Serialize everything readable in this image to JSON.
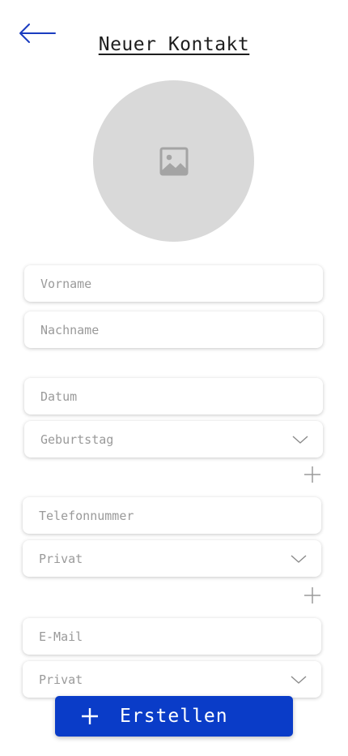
{
  "header": {
    "title": "Neuer Kontakt",
    "back_icon": "arrow-left-icon"
  },
  "avatar": {
    "icon": "image-placeholder-icon"
  },
  "form": {
    "first_name_placeholder": "Vorname",
    "last_name_placeholder": "Nachname",
    "date_placeholder": "Datum",
    "date_type": "Geburtstag",
    "phone_placeholder": "Telefonnummer",
    "phone_type": "Privat",
    "email_placeholder": "E-Mail",
    "email_type": "Privat"
  },
  "actions": {
    "create_label": "Erstellen",
    "add_icon": "plus-icon"
  },
  "colors": {
    "accent": "#0a3cc8",
    "placeholder_bg": "#d9d9d9",
    "muted_text": "#9a9a9a"
  }
}
